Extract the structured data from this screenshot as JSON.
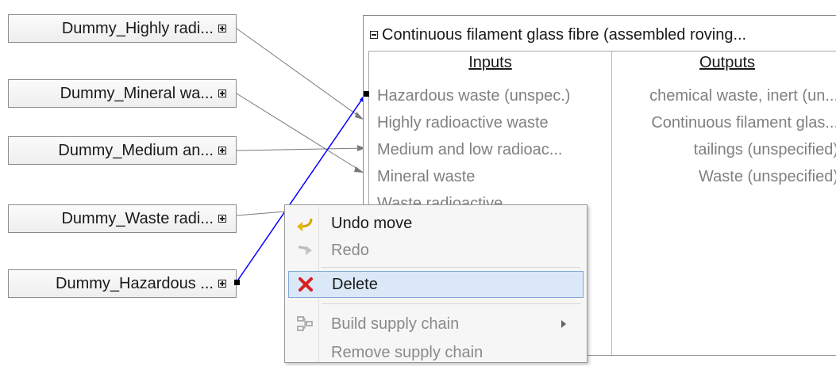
{
  "source_nodes": [
    {
      "label": "Dummy_Highly radi..."
    },
    {
      "label": "Dummy_Mineral wa..."
    },
    {
      "label": "Dummy_Medium an..."
    },
    {
      "label": "Dummy_Waste radi..."
    },
    {
      "label": "Dummy_Hazardous ..."
    }
  ],
  "process": {
    "title": "Continuous filament glass fibre (assembled roving...",
    "inputs_header": "Inputs",
    "outputs_header": "Outputs",
    "inputs": [
      "Hazardous waste (unspec.)",
      "Highly radioactive waste",
      "Medium and low radioac...",
      "Mineral waste",
      "Waste radioactive"
    ],
    "outputs": [
      "chemical waste, inert (un...",
      "Continuous filament glas...",
      "tailings (unspecified)",
      "Waste (unspecified)"
    ]
  },
  "context_menu": {
    "items": [
      {
        "label": "Undo move",
        "icon": "undo-icon",
        "enabled": true
      },
      {
        "label": "Redo",
        "icon": "redo-icon",
        "enabled": false
      },
      {
        "label": "Delete",
        "icon": "delete-icon",
        "enabled": true,
        "selected": true
      },
      {
        "label": "Build supply chain",
        "icon": "supply-chain-icon",
        "enabled": false,
        "submenu": true
      },
      {
        "label": "Remove supply chain",
        "icon": "",
        "enabled": false
      }
    ]
  },
  "colors": {
    "selected_link": "#0000ff",
    "link": "#7a7a7a",
    "menu_selection": "#dbe8f7"
  }
}
